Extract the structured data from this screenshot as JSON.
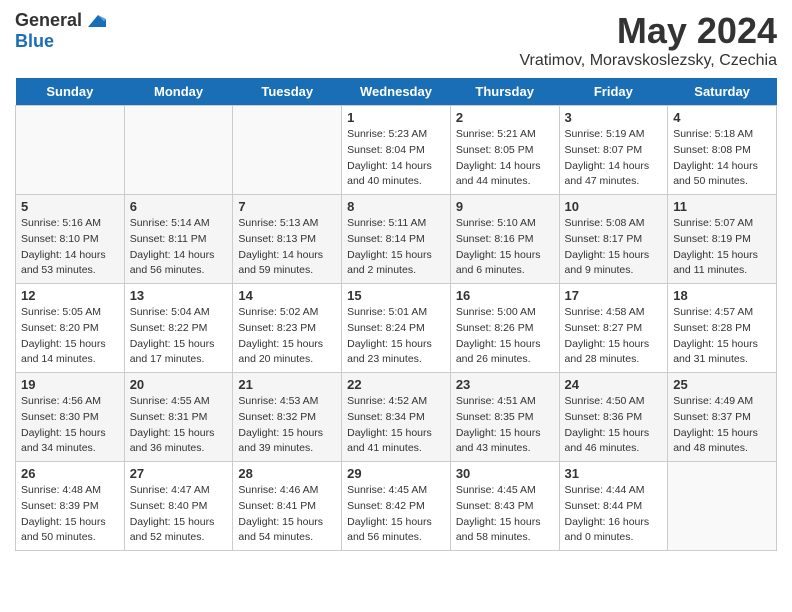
{
  "header": {
    "logo_general": "General",
    "logo_blue": "Blue",
    "month_year": "May 2024",
    "location": "Vratimov, Moravskoslezsky, Czechia"
  },
  "days_of_week": [
    "Sunday",
    "Monday",
    "Tuesday",
    "Wednesday",
    "Thursday",
    "Friday",
    "Saturday"
  ],
  "weeks": [
    [
      {
        "day": "",
        "sunrise": "",
        "sunset": "",
        "daylight": "",
        "empty": true
      },
      {
        "day": "",
        "sunrise": "",
        "sunset": "",
        "daylight": "",
        "empty": true
      },
      {
        "day": "",
        "sunrise": "",
        "sunset": "",
        "daylight": "",
        "empty": true
      },
      {
        "day": "1",
        "sunrise": "5:23 AM",
        "sunset": "8:04 PM",
        "daylight": "14 hours and 40 minutes."
      },
      {
        "day": "2",
        "sunrise": "5:21 AM",
        "sunset": "8:05 PM",
        "daylight": "14 hours and 44 minutes."
      },
      {
        "day": "3",
        "sunrise": "5:19 AM",
        "sunset": "8:07 PM",
        "daylight": "14 hours and 47 minutes."
      },
      {
        "day": "4",
        "sunrise": "5:18 AM",
        "sunset": "8:08 PM",
        "daylight": "14 hours and 50 minutes."
      }
    ],
    [
      {
        "day": "5",
        "sunrise": "5:16 AM",
        "sunset": "8:10 PM",
        "daylight": "14 hours and 53 minutes."
      },
      {
        "day": "6",
        "sunrise": "5:14 AM",
        "sunset": "8:11 PM",
        "daylight": "14 hours and 56 minutes."
      },
      {
        "day": "7",
        "sunrise": "5:13 AM",
        "sunset": "8:13 PM",
        "daylight": "14 hours and 59 minutes."
      },
      {
        "day": "8",
        "sunrise": "5:11 AM",
        "sunset": "8:14 PM",
        "daylight": "15 hours and 2 minutes."
      },
      {
        "day": "9",
        "sunrise": "5:10 AM",
        "sunset": "8:16 PM",
        "daylight": "15 hours and 6 minutes."
      },
      {
        "day": "10",
        "sunrise": "5:08 AM",
        "sunset": "8:17 PM",
        "daylight": "15 hours and 9 minutes."
      },
      {
        "day": "11",
        "sunrise": "5:07 AM",
        "sunset": "8:19 PM",
        "daylight": "15 hours and 11 minutes."
      }
    ],
    [
      {
        "day": "12",
        "sunrise": "5:05 AM",
        "sunset": "8:20 PM",
        "daylight": "15 hours and 14 minutes."
      },
      {
        "day": "13",
        "sunrise": "5:04 AM",
        "sunset": "8:22 PM",
        "daylight": "15 hours and 17 minutes."
      },
      {
        "day": "14",
        "sunrise": "5:02 AM",
        "sunset": "8:23 PM",
        "daylight": "15 hours and 20 minutes."
      },
      {
        "day": "15",
        "sunrise": "5:01 AM",
        "sunset": "8:24 PM",
        "daylight": "15 hours and 23 minutes."
      },
      {
        "day": "16",
        "sunrise": "5:00 AM",
        "sunset": "8:26 PM",
        "daylight": "15 hours and 26 minutes."
      },
      {
        "day": "17",
        "sunrise": "4:58 AM",
        "sunset": "8:27 PM",
        "daylight": "15 hours and 28 minutes."
      },
      {
        "day": "18",
        "sunrise": "4:57 AM",
        "sunset": "8:28 PM",
        "daylight": "15 hours and 31 minutes."
      }
    ],
    [
      {
        "day": "19",
        "sunrise": "4:56 AM",
        "sunset": "8:30 PM",
        "daylight": "15 hours and 34 minutes."
      },
      {
        "day": "20",
        "sunrise": "4:55 AM",
        "sunset": "8:31 PM",
        "daylight": "15 hours and 36 minutes."
      },
      {
        "day": "21",
        "sunrise": "4:53 AM",
        "sunset": "8:32 PM",
        "daylight": "15 hours and 39 minutes."
      },
      {
        "day": "22",
        "sunrise": "4:52 AM",
        "sunset": "8:34 PM",
        "daylight": "15 hours and 41 minutes."
      },
      {
        "day": "23",
        "sunrise": "4:51 AM",
        "sunset": "8:35 PM",
        "daylight": "15 hours and 43 minutes."
      },
      {
        "day": "24",
        "sunrise": "4:50 AM",
        "sunset": "8:36 PM",
        "daylight": "15 hours and 46 minutes."
      },
      {
        "day": "25",
        "sunrise": "4:49 AM",
        "sunset": "8:37 PM",
        "daylight": "15 hours and 48 minutes."
      }
    ],
    [
      {
        "day": "26",
        "sunrise": "4:48 AM",
        "sunset": "8:39 PM",
        "daylight": "15 hours and 50 minutes."
      },
      {
        "day": "27",
        "sunrise": "4:47 AM",
        "sunset": "8:40 PM",
        "daylight": "15 hours and 52 minutes."
      },
      {
        "day": "28",
        "sunrise": "4:46 AM",
        "sunset": "8:41 PM",
        "daylight": "15 hours and 54 minutes."
      },
      {
        "day": "29",
        "sunrise": "4:45 AM",
        "sunset": "8:42 PM",
        "daylight": "15 hours and 56 minutes."
      },
      {
        "day": "30",
        "sunrise": "4:45 AM",
        "sunset": "8:43 PM",
        "daylight": "15 hours and 58 minutes."
      },
      {
        "day": "31",
        "sunrise": "4:44 AM",
        "sunset": "8:44 PM",
        "daylight": "16 hours and 0 minutes."
      },
      {
        "day": "",
        "sunrise": "",
        "sunset": "",
        "daylight": "",
        "empty": true
      }
    ]
  ],
  "labels": {
    "sunrise_prefix": "Sunrise: ",
    "sunset_prefix": "Sunset: ",
    "daylight_prefix": "Daylight: "
  }
}
